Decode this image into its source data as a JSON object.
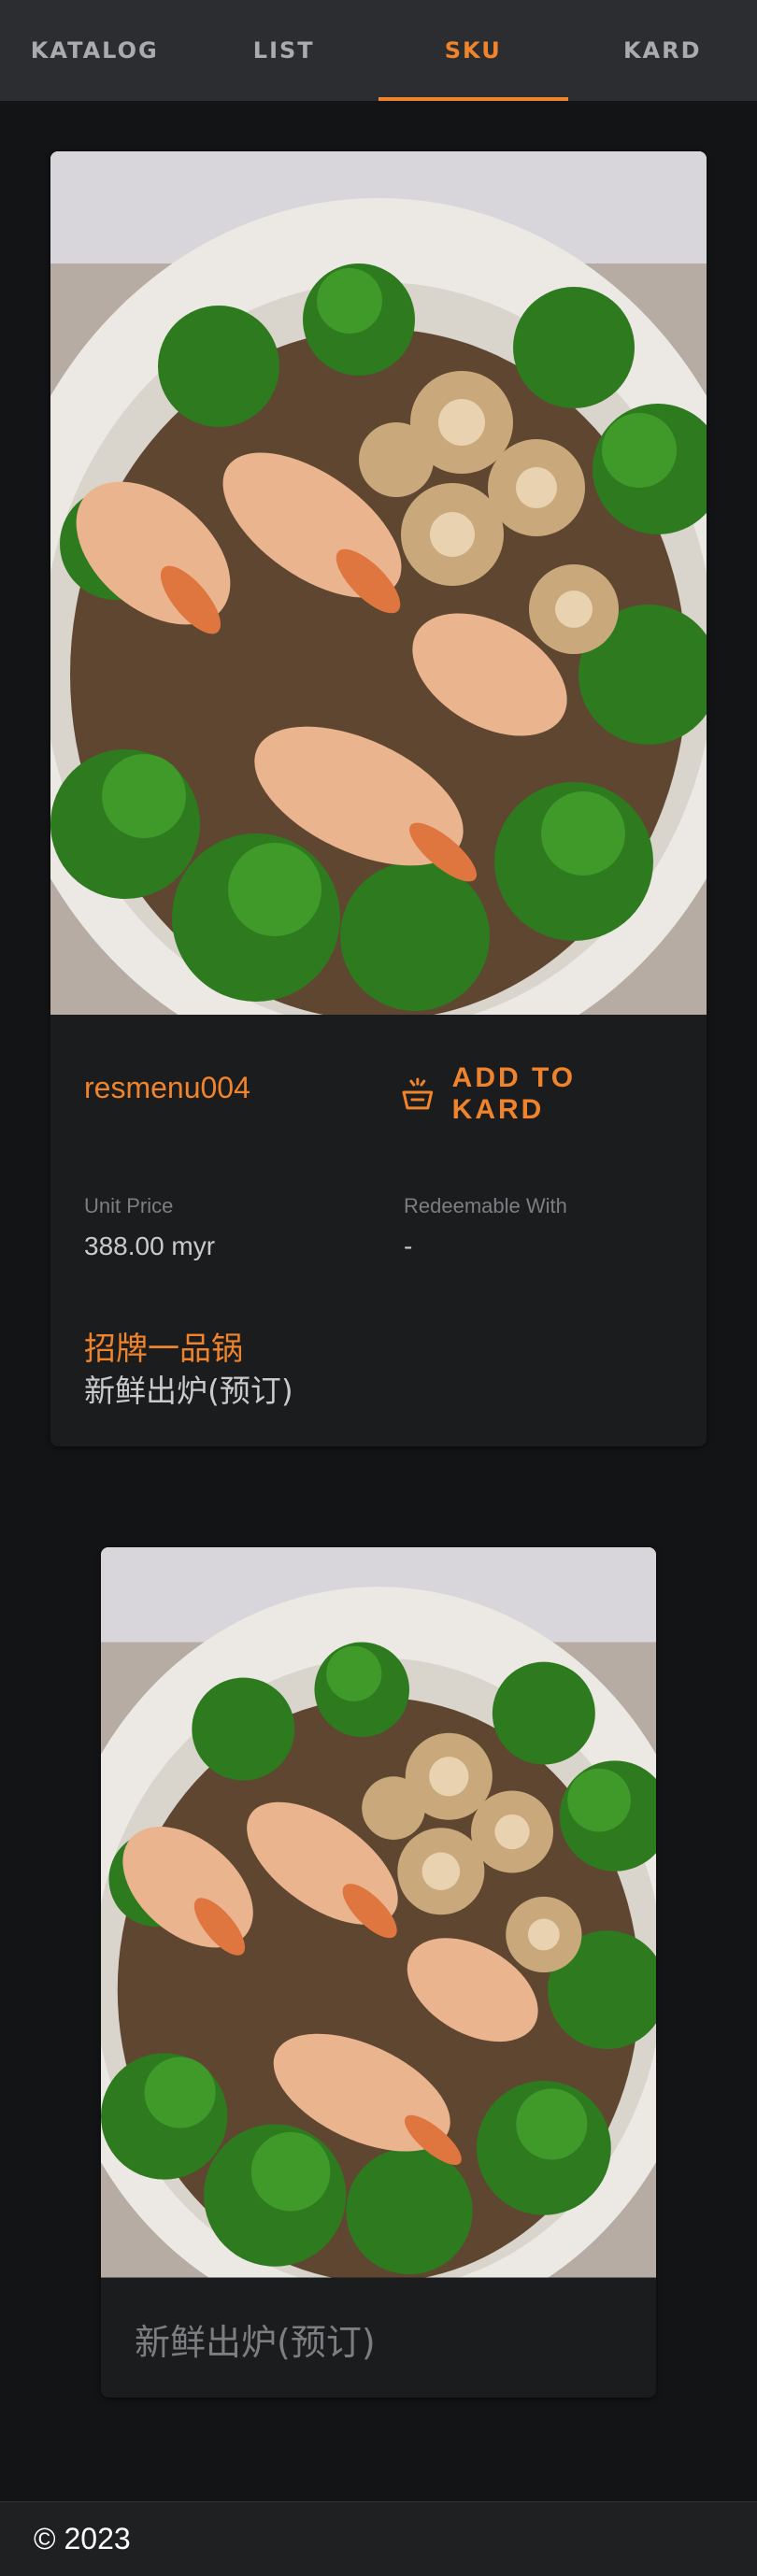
{
  "tabs": [
    {
      "label": "KATALOG",
      "active": false
    },
    {
      "label": "LIST",
      "active": false
    },
    {
      "label": "SKU",
      "active": true
    },
    {
      "label": "KARD",
      "active": false
    }
  ],
  "colors": {
    "accent": "#f0842c",
    "background": "#131416",
    "card": "#1b1c1e",
    "tabbar": "#2b2d30"
  },
  "sku": {
    "image_alt": "Claypot with prawns, abalone and broccoli",
    "name": "resmenu004",
    "add_button_label": "ADD TO KARD",
    "add_button_icon": "basket-icon",
    "unit_price_label": "Unit Price",
    "unit_price_value": "388.00 myr",
    "redeemable_label": "Redeemable With",
    "redeemable_value": "-",
    "title_cn": "招牌一品锅",
    "subtitle_cn": "新鲜出炉(预订)"
  },
  "related": {
    "caption": "新鲜出炉(预订)"
  },
  "footer": {
    "copyright": "© 2023"
  }
}
